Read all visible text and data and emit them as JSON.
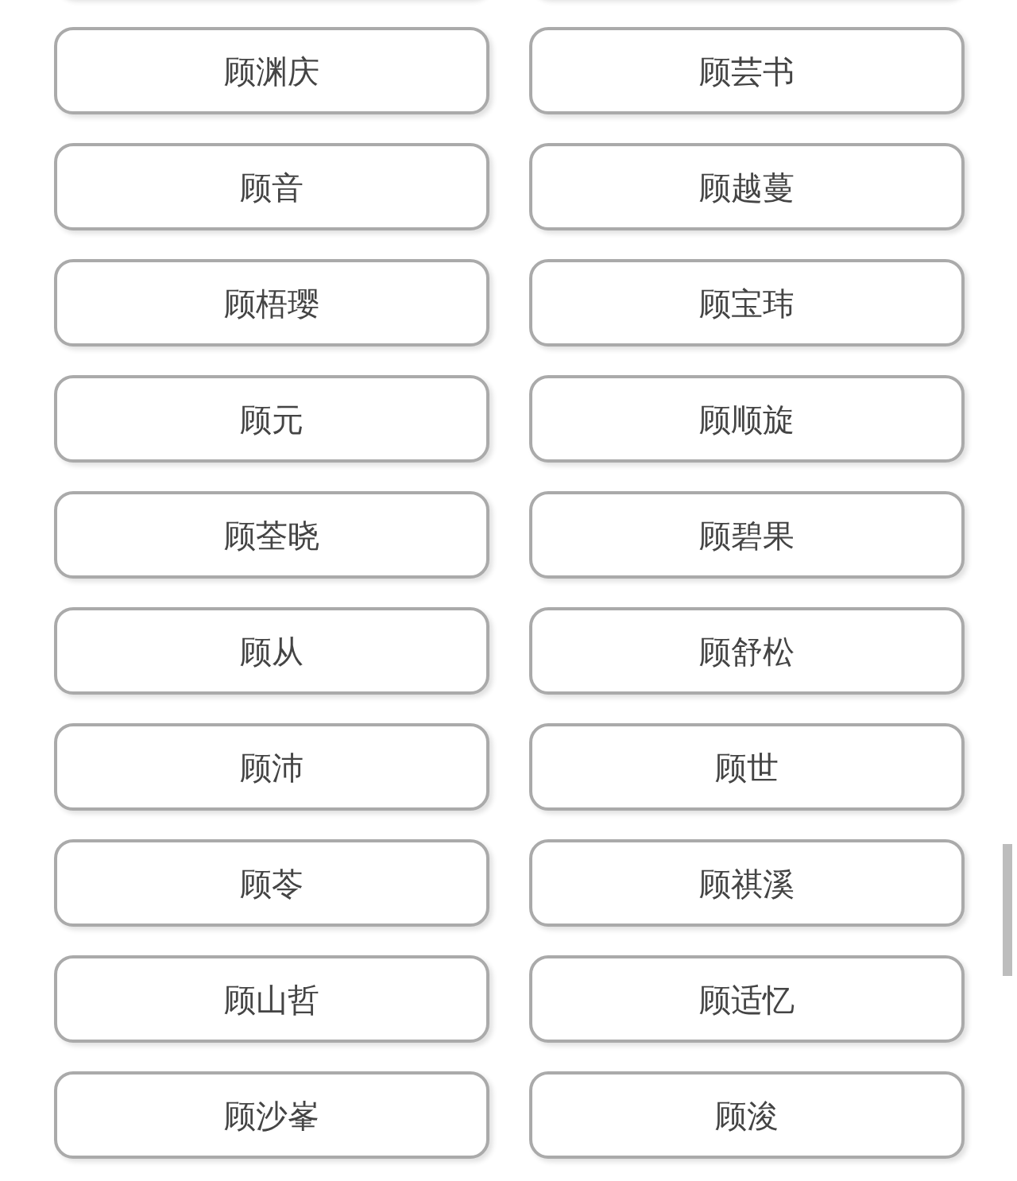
{
  "names": [
    {
      "label": "顾渊庆"
    },
    {
      "label": "顾芸书"
    },
    {
      "label": "顾音"
    },
    {
      "label": "顾越蔓"
    },
    {
      "label": "顾梧璎"
    },
    {
      "label": "顾宝玮"
    },
    {
      "label": "顾元"
    },
    {
      "label": "顾顺旋"
    },
    {
      "label": "顾荃晓"
    },
    {
      "label": "顾碧果"
    },
    {
      "label": "顾从"
    },
    {
      "label": "顾舒松"
    },
    {
      "label": "顾沛"
    },
    {
      "label": "顾世"
    },
    {
      "label": "顾苓"
    },
    {
      "label": "顾祺溪"
    },
    {
      "label": "顾山哲"
    },
    {
      "label": "顾适忆"
    },
    {
      "label": "顾沙峯"
    },
    {
      "label": "顾浚"
    }
  ]
}
